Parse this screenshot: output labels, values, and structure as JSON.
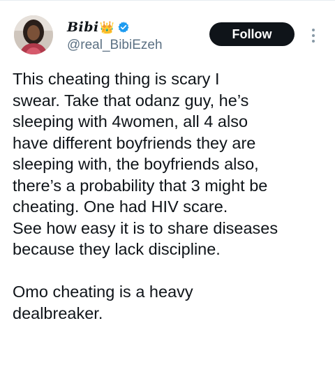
{
  "tweet": {
    "author": {
      "display_name": "Bibi",
      "crown_icon": "👑",
      "verified_icon": "verified-badge-icon",
      "handle": "@real_BibiEzeh"
    },
    "follow_label": "Follow",
    "body_lines": [
      "This cheating thing is scary I",
      "swear. Take that odanz guy, he’s",
      "sleeping with 4women, all 4 also",
      "have different boyfriends they are",
      "sleeping with, the boyfriends also,",
      "there’s a probability that 3 might be",
      "cheating. One had HIV scare.",
      "See how easy it is to share diseases",
      "because they lack discipline."
    ],
    "closing_lines": [
      "Omo cheating is a heavy",
      "dealbreaker."
    ]
  },
  "colors": {
    "accent": "#1d9bf0",
    "follow_bg": "#0f1419",
    "text": "#0f1419",
    "secondary_text": "#5b7083"
  }
}
